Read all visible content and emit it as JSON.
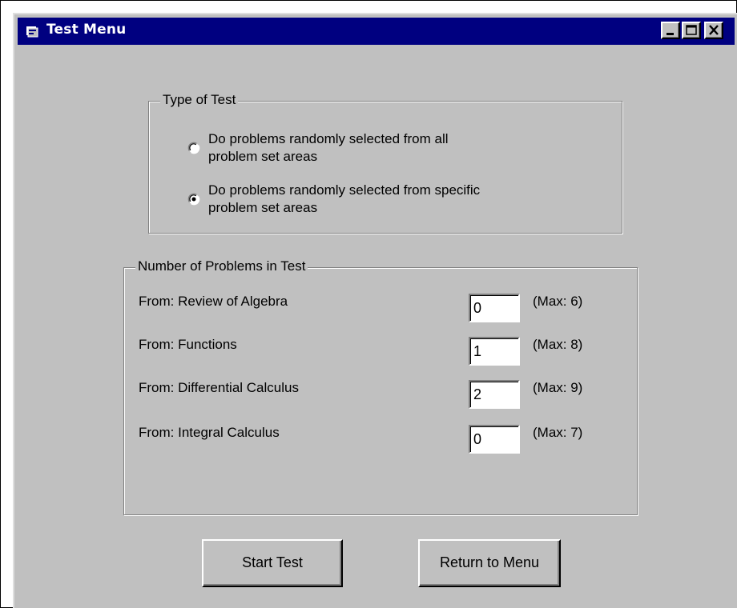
{
  "window": {
    "title": "Test Menu",
    "controls": {
      "minimize_icon": "minimize-icon",
      "maximize_icon": "maximize-icon",
      "close_icon": "close-icon"
    }
  },
  "type_of_test": {
    "label": "Type of Test",
    "options": [
      {
        "label": "Do problems randomly selected from all problem set areas",
        "line1": "Do problems randomly selected from all",
        "line2": "problem set areas",
        "selected": false
      },
      {
        "label": "Do problems randomly selected from specific problem set areas",
        "line1": "Do problems randomly selected from specific",
        "line2": "problem set areas",
        "selected": true
      }
    ]
  },
  "problems": {
    "label": "Number of Problems in Test",
    "rows": [
      {
        "label": "From: Review of Algebra",
        "value": "0",
        "max": "(Max: 6)"
      },
      {
        "label": "From: Functions",
        "value": "1",
        "max": "(Max: 8)"
      },
      {
        "label": "From: Differential Calculus",
        "value": "2",
        "max": "(Max: 9)"
      },
      {
        "label": "From: Integral Calculus",
        "value": "0",
        "max": "(Max: 7)"
      }
    ]
  },
  "buttons": {
    "start": "Start Test",
    "return": "Return to Menu"
  },
  "colors": {
    "titlebar": "#000080",
    "face": "#c0c0c0"
  }
}
